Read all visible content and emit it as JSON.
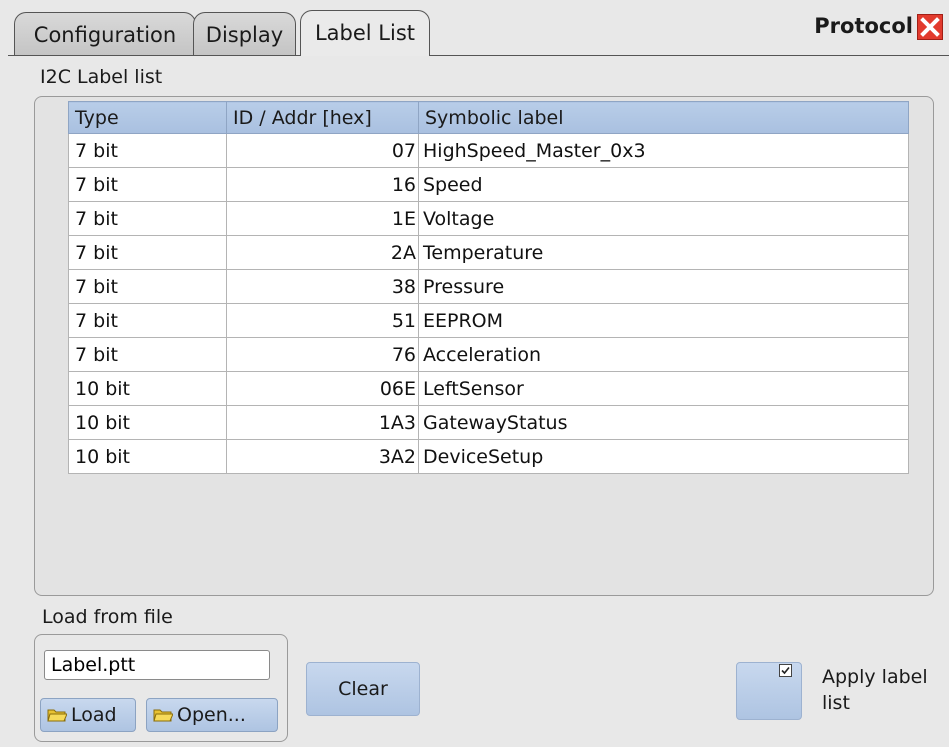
{
  "tabs": [
    {
      "label": "Configuration"
    },
    {
      "label": "Display"
    },
    {
      "label": "Label List"
    }
  ],
  "active_tab": "Label List",
  "dialog_title": "Protocol",
  "label_list": {
    "group_label": "I2C Label list",
    "columns": [
      "Type",
      "ID / Addr [hex]",
      "Symbolic label"
    ],
    "rows": [
      {
        "type": "7 bit",
        "addr": "07",
        "label": "HighSpeed_Master_0x3"
      },
      {
        "type": "7 bit",
        "addr": "16",
        "label": "Speed"
      },
      {
        "type": "7 bit",
        "addr": "1E",
        "label": "Voltage"
      },
      {
        "type": "7 bit",
        "addr": "2A",
        "label": "Temperature"
      },
      {
        "type": "7 bit",
        "addr": "38",
        "label": "Pressure"
      },
      {
        "type": "7 bit",
        "addr": "51",
        "label": "EEPROM"
      },
      {
        "type": "7 bit",
        "addr": "76",
        "label": "Acceleration"
      },
      {
        "type": "10 bit",
        "addr": "06E",
        "label": "LeftSensor"
      },
      {
        "type": "10 bit",
        "addr": "1A3",
        "label": "GatewayStatus"
      },
      {
        "type": "10 bit",
        "addr": "3A2",
        "label": "DeviceSetup"
      }
    ]
  },
  "load_from_file": {
    "group_label": "Load from file",
    "file_value": "Label.ptt",
    "load_label": "Load",
    "open_label": "Open..."
  },
  "clear_label": "Clear",
  "apply_label_list": {
    "label_line1": "Apply label",
    "label_line2": "list",
    "checked": true
  },
  "colors": {
    "close_button": "#e23b2e",
    "header_bg": "#b2c7e4",
    "button_bg": "#bccfe8"
  }
}
